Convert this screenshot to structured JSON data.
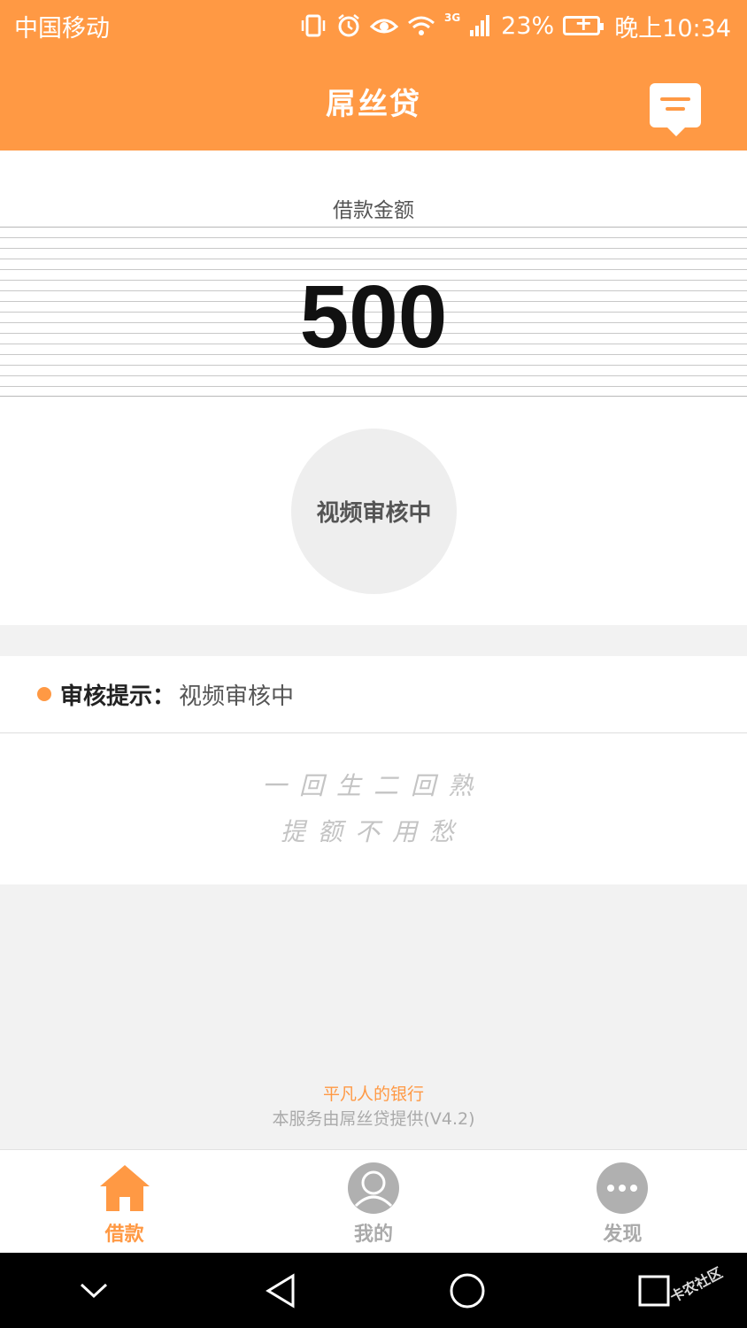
{
  "status_bar": {
    "carrier": "中国移动",
    "network": "3G",
    "battery_percent": "23%",
    "time": "晚上10:34"
  },
  "header": {
    "title": "屌丝贷"
  },
  "loan": {
    "amount_label": "借款金额",
    "amount_value": "500",
    "status_text": "视频审核中"
  },
  "notice": {
    "label": "审核提示：",
    "value": "视频审核中"
  },
  "slogan": {
    "line1": "一回生二回熟",
    "line2": "提额不用愁"
  },
  "footer": {
    "slogan": "平凡人的银行",
    "provider": "本服务由屌丝贷提供(V4.2)"
  },
  "tabs": [
    {
      "label": "借款",
      "icon": "home-icon",
      "active": true
    },
    {
      "label": "我的",
      "icon": "user-icon",
      "active": false
    },
    {
      "label": "发现",
      "icon": "more-icon",
      "active": false
    }
  ],
  "colors": {
    "brand": "#ff9944",
    "inactive": "#aaaaaa"
  },
  "watermark": {
    "text": "卡农社区"
  }
}
